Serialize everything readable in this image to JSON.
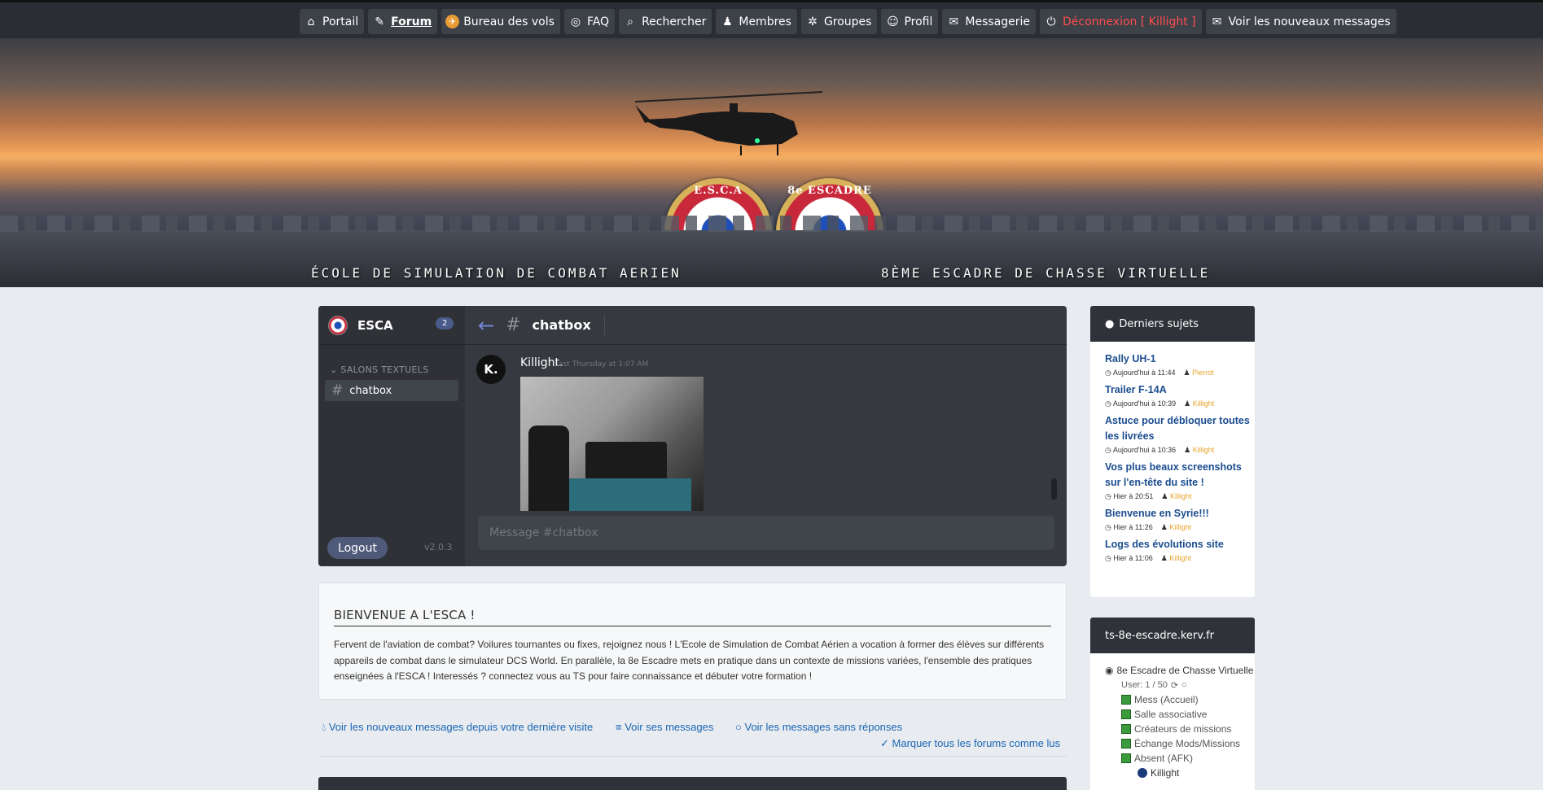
{
  "nav": [
    {
      "label": "Portail",
      "icon": "home-icon",
      "glyph": "⌂"
    },
    {
      "label": "Forum",
      "icon": "forum-icon",
      "glyph": "✎",
      "active": true
    },
    {
      "label": "Bureau des vols",
      "icon": "plane-icon",
      "glyph": "✈"
    },
    {
      "label": "FAQ",
      "icon": "lifebuoy-icon",
      "glyph": "◎"
    },
    {
      "label": "Rechercher",
      "icon": "search-icon",
      "glyph": "⌕"
    },
    {
      "label": "Membres",
      "icon": "members-icon",
      "glyph": "♟"
    },
    {
      "label": "Groupes",
      "icon": "groups-icon",
      "glyph": "✲"
    },
    {
      "label": "Profil",
      "icon": "profile-icon",
      "glyph": "☺"
    },
    {
      "label": "Messagerie",
      "icon": "mail-icon",
      "glyph": "✉"
    },
    {
      "label": "Déconnexion [ Killight ]",
      "icon": "logout-icon",
      "glyph": "⏻"
    },
    {
      "label": "Voir les nouveaux messages",
      "icon": "new-messages-icon",
      "glyph": "✉"
    }
  ],
  "banner": {
    "left_text": "ÉCOLE DE SIMULATION DE COMBAT AERIEN",
    "right_text": "8ÈME ESCADRE DE CHASSE VIRTUELLE",
    "seal_left": "E.S.C.A",
    "seal_right": "8e ESCADRE"
  },
  "chat": {
    "server_name": "ESCA",
    "badge": "2",
    "section": "SALONS TEXTUELS",
    "channel": "chatbox",
    "channel_title": "chatbox",
    "logout": "Logout",
    "version": "v2.0.3",
    "message": {
      "author": "Killight.",
      "avatar_letter": "K.",
      "time": "Last Thursday at 1:07 AM"
    },
    "input_placeholder": "Message #chatbox"
  },
  "welcome": {
    "title": "BIENVENUE A L'ESCA !",
    "body": "Fervent de l'aviation de combat? Voilures tournantes ou fixes, rejoignez nous ! L'Ecole de Simulation de Combat Aérien a vocation à former des élèves sur différents appareils de combat dans le simulateur DCS World. En parallèle, la 8e Escadre mets en pratique dans un contexte de missions variées, l'ensemble des pratiques enseignées à l'ESCA ! Interessés ? connectez vous au TS pour faire connaissance et débuter votre formation !"
  },
  "links": {
    "new_since": "Voir les nouveaux messages depuis votre dernière visite",
    "own": "Voir ses messages",
    "unanswered": "Voir les messages sans réponses",
    "mark_read": "Marquer tous les forums comme lus"
  },
  "latest": {
    "title": "Derniers sujets",
    "items": [
      {
        "title": "Rally UH-1",
        "time": "Aujourd'hui à 11:44",
        "user": "Pierrot"
      },
      {
        "title": "Trailer F-14A",
        "time": "Aujourd'hui à 10:39",
        "user": "Killight"
      },
      {
        "title": "Astuce pour débloquer toutes les livrées",
        "time": "Aujourd'hui à 10:36",
        "user": "Killight"
      },
      {
        "title": "Vos plus beaux screenshots sur l'en-tête du site !",
        "time": "Hier à 20:51",
        "user": "Killight"
      },
      {
        "title": "Bienvenue en Syrie!!!",
        "time": "Hier à 11:26",
        "user": "Killight"
      },
      {
        "title": "Logs des évolutions site",
        "time": "Hier à 11:06",
        "user": "Killight"
      }
    ]
  },
  "ts": {
    "title": "ts-8e-escadre.kerv.fr",
    "server": "8e Escadre de Chasse Virtuelle",
    "users": "User: 1 / 50",
    "channels": [
      "Mess (Accueil)",
      "Salle associative",
      "Créateurs de missions",
      "Échange Mods/Missions",
      "Absent (AFK)"
    ],
    "user": "Killight"
  }
}
